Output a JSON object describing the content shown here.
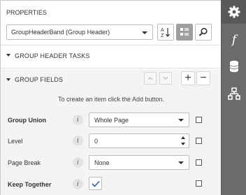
{
  "panel": {
    "title": "PROPERTIES",
    "selector_value": "GroupHeaderBand (Group Header)",
    "sort_icon": "sort-az-icon",
    "categories_icon": "categories-icon",
    "search_icon": "search-icon"
  },
  "sections": {
    "tasks": "GROUP HEADER TASKS",
    "fields": "GROUP FIELDS",
    "hint": "To create an item click the Add button."
  },
  "properties": [
    {
      "label": "Group Union",
      "value": "Whole Page",
      "bold": true
    },
    {
      "label": "Level",
      "value": "0",
      "bold": false
    },
    {
      "label": "Page Break",
      "value": "None",
      "bold": false
    },
    {
      "label": "Keep Together",
      "value": "",
      "checked": true,
      "bold": true
    }
  ],
  "info_glyph": "i",
  "buttons": {
    "add": "+",
    "remove": "−"
  },
  "sidebar": {
    "tabs": [
      "gear-icon",
      "function-icon",
      "database-icon",
      "hierarchy-icon"
    ],
    "function_glyph": "f"
  },
  "colors": {
    "sidebar": "#6b6b6b",
    "accent_check": "#2a5fb0",
    "selected_toggle": "#9e9e9e"
  }
}
